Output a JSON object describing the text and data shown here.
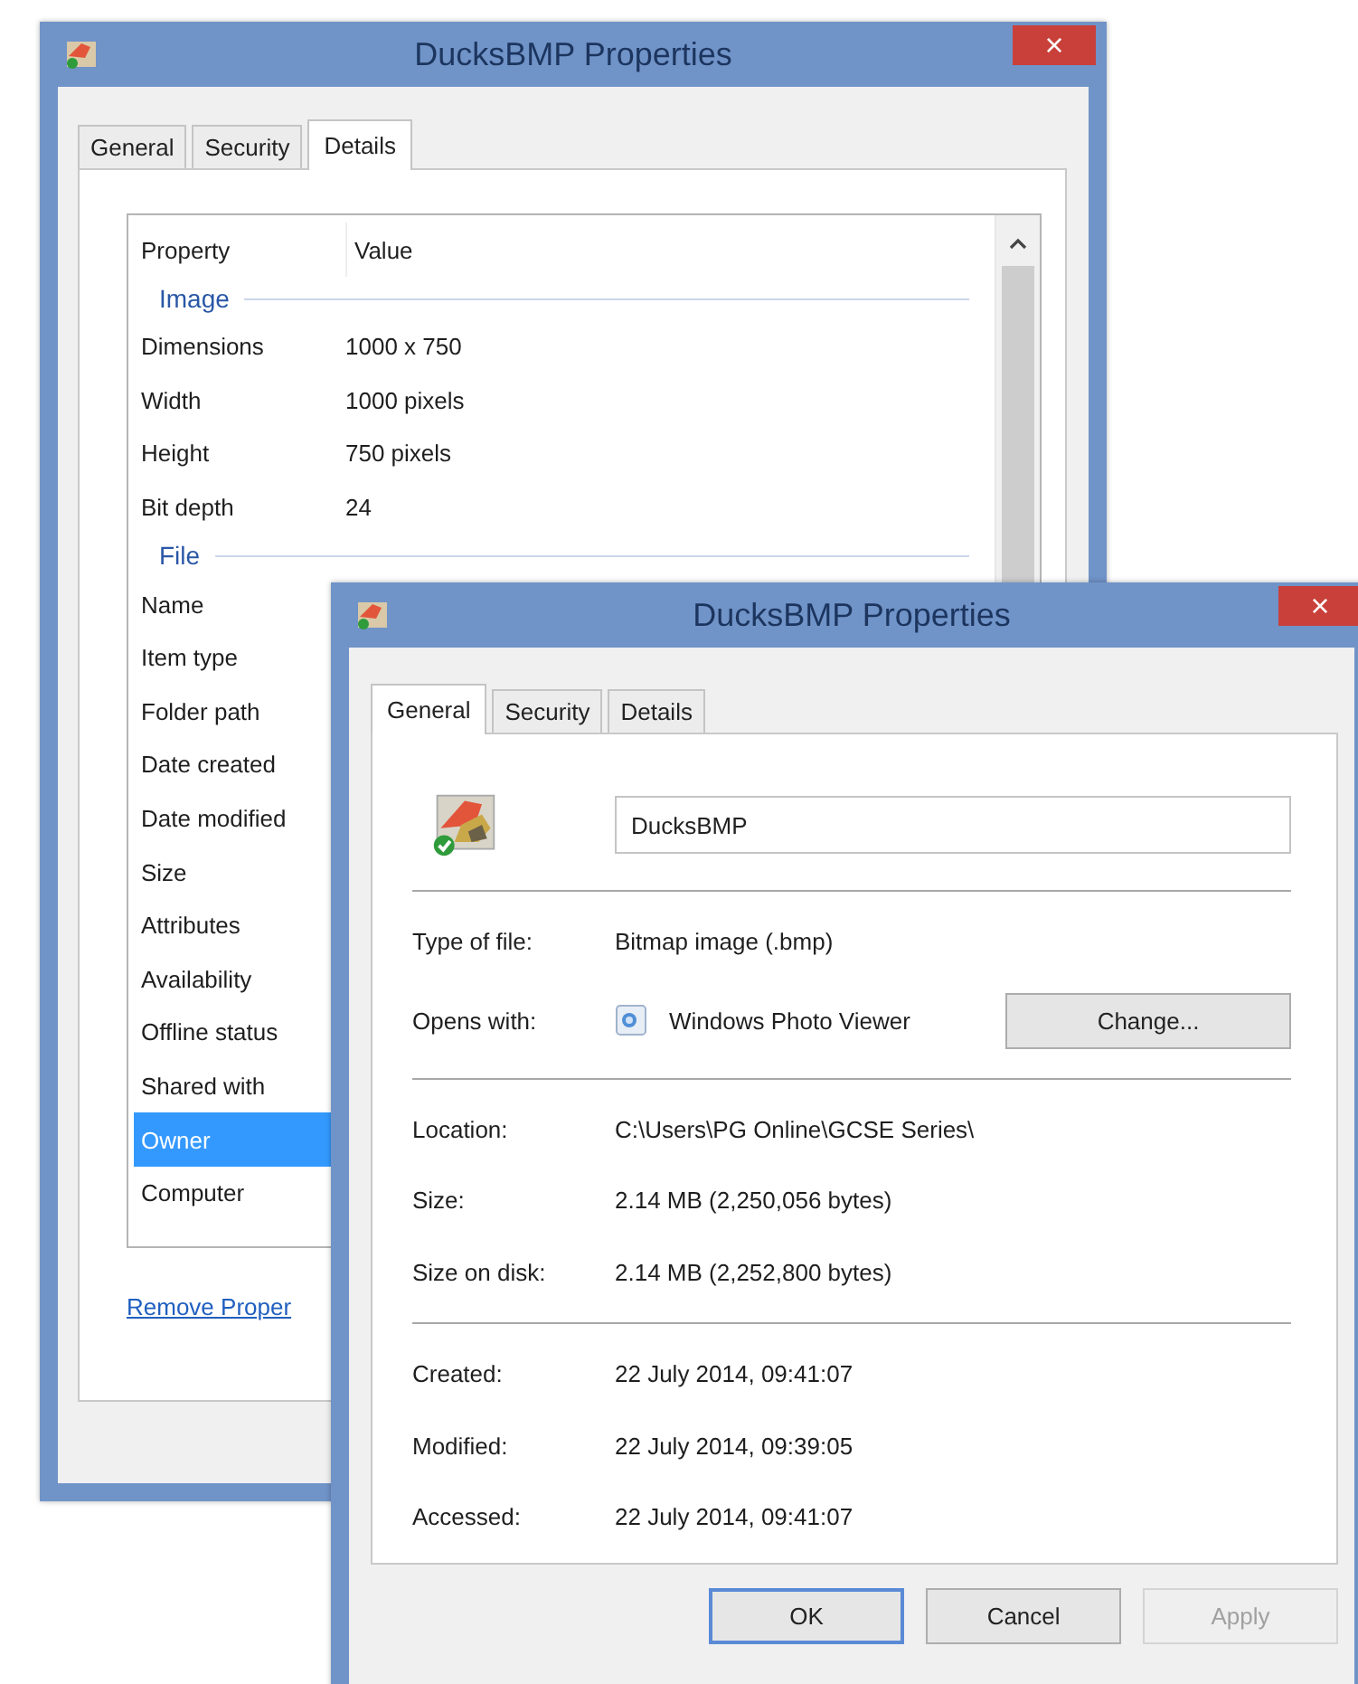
{
  "back_window": {
    "title": "DucksBMP Properties",
    "close": "×",
    "tabs": [
      {
        "label": "General",
        "selected": false
      },
      {
        "label": "Security",
        "selected": false
      },
      {
        "label": "Details",
        "selected": true
      }
    ],
    "columns": [
      "Property",
      "Value"
    ],
    "groups": [
      {
        "name": "Image",
        "rows": [
          {
            "property": "Dimensions",
            "value": "1000 x 750",
            "selected": false
          },
          {
            "property": "Width",
            "value": "1000 pixels",
            "selected": false
          },
          {
            "property": "Height",
            "value": "750 pixels",
            "selected": false
          },
          {
            "property": "Bit depth",
            "value": "24",
            "selected": false
          }
        ]
      },
      {
        "name": "File",
        "rows": [
          {
            "property": "Name",
            "selected": false
          },
          {
            "property": "Item type",
            "selected": false
          },
          {
            "property": "Folder path",
            "selected": false
          },
          {
            "property": "Date created",
            "selected": false
          },
          {
            "property": "Date modified",
            "selected": false
          },
          {
            "property": "Size",
            "selected": false
          },
          {
            "property": "Attributes",
            "selected": false
          },
          {
            "property": "Availability",
            "selected": false
          },
          {
            "property": "Offline status",
            "selected": false
          },
          {
            "property": "Shared with",
            "selected": false
          },
          {
            "property": "Owner",
            "selected": true
          },
          {
            "property": "Computer",
            "selected": false
          }
        ]
      }
    ],
    "link": "Remove Proper"
  },
  "front_window": {
    "title": "DucksBMP Properties",
    "close": "×",
    "tabs": [
      {
        "label": "General",
        "selected": true
      },
      {
        "label": "Security",
        "selected": false
      },
      {
        "label": "Details",
        "selected": false
      }
    ],
    "file_name": "DucksBMP",
    "sections": [
      [
        {
          "kind": "text",
          "label": "Type of file:",
          "value": "Bitmap image (.bmp)"
        },
        {
          "kind": "app",
          "label": "Opens with:",
          "value": "Windows Photo Viewer",
          "button": "Change..."
        }
      ],
      [
        {
          "kind": "text",
          "label": "Location:",
          "value": "C:\\Users\\PG Online\\GCSE Series\\"
        },
        {
          "kind": "text",
          "label": "Size:",
          "value": "2.14 MB (2,250,056 bytes)"
        },
        {
          "kind": "text",
          "label": "Size on disk:",
          "value": "2.14 MB (2,252,800 bytes)"
        }
      ],
      [
        {
          "kind": "text",
          "label": "Created:",
          "value": "22 July 2014, 09:41:07"
        },
        {
          "kind": "text",
          "label": "Modified:",
          "value": "22 July 2014, 09:39:05"
        },
        {
          "kind": "text",
          "label": "Accessed:",
          "value": "22 July 2014, 09:41:07"
        }
      ]
    ],
    "buttons": [
      {
        "label": "OK",
        "default": true,
        "disabled": false
      },
      {
        "label": "Cancel",
        "default": false,
        "disabled": false
      },
      {
        "label": "Apply",
        "default": false,
        "disabled": true
      }
    ]
  }
}
